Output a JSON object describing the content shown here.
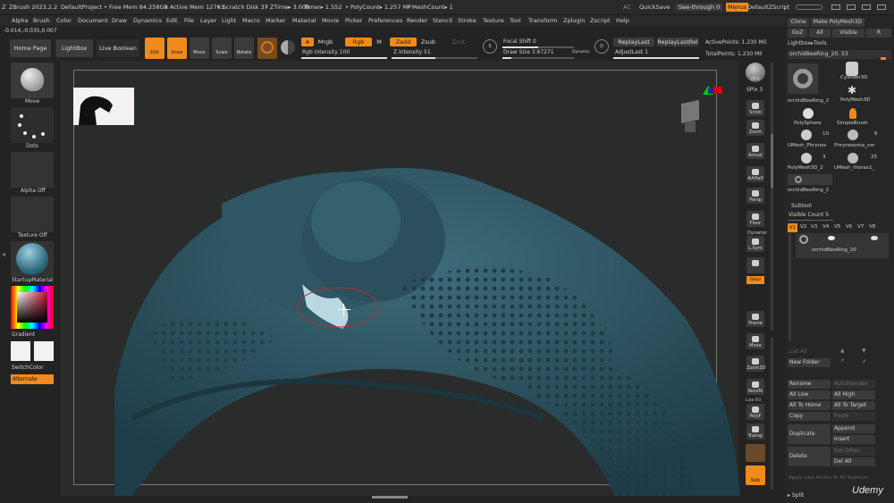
{
  "titlebar": {
    "app": "ZBrush 2023.2.2",
    "project": "DefaultProject",
    "freemem": "• Free Mem 84.258GB",
    "activemem": "• Active Mem 12763",
    "scratch": "• Scratch Disk 37",
    "ztime": "• ZTime▸ 3.008",
    "timer": "Timer▸ 1.552",
    "polycount": "• PolyCount▸ 1.257 MP",
    "meshcount": "• MeshCount▸ 1",
    "ac": "AC",
    "quicksave": "QuickSave",
    "seethrough": "See-through",
    "seethrough_val": "0",
    "menus": "Menus",
    "script": "DefaultZScript"
  },
  "menu": [
    "Alpha",
    "Brush",
    "Color",
    "Document",
    "Draw",
    "Dynamics",
    "Edit",
    "File",
    "Layer",
    "Light",
    "Macro",
    "Marker",
    "Material",
    "Movie",
    "Picker",
    "Preferences",
    "Render",
    "Stencil",
    "Stroke",
    "Texture",
    "Tool",
    "Transform",
    "Zplugin",
    "Zscript",
    "Help"
  ],
  "coords": "-0.014,-0.035,0.007",
  "toolbar": {
    "home": "Home Page",
    "lightbox": "LightBox",
    "liveboolean": "Live Boolean",
    "edit": "Edit",
    "draw": "Draw",
    "move": "Move",
    "scale": "Scale",
    "rotate": "Rotate",
    "a": "A",
    "mrgb": "Mrgb",
    "rgb": "Rgb",
    "m": "M",
    "zadd": "Zadd",
    "zsub": "Zsub",
    "zcut": "Zcut",
    "rgb_intensity": "Rgb Intensity 100",
    "z_intensity": "Z Intensity 51",
    "s": "S",
    "d": "D",
    "focal": "Focal Shift 0",
    "drawsize": "Draw Size 3.67271",
    "dynamic": "Dynamic",
    "replaylast": "ReplayLast",
    "replaylastrel": "ReplayLastRel",
    "adjustlast": "AdjustLast 1",
    "activepoints": "ActivePoints: 1.230 Mil",
    "totalpoints": "TotalPoints: 1.230 Mil",
    "rgb_intensity_value": 100,
    "z_intensity_value": 51
  },
  "leftshelf": {
    "move": "Move",
    "dots": "Dots",
    "alpha": "Alpha Off",
    "texture": "Texture Off",
    "material": "StartupMaterial",
    "gradient": "Gradient",
    "switchcolor": "SwitchColor",
    "alternate": "Alternate"
  },
  "rightshelf": {
    "bpr": "BPR",
    "spix": "SPix 3",
    "scroll": "Scroll",
    "zoom": "Zoom",
    "actual": "Actual",
    "aahalf": "AAHalf",
    "persp": "Persp",
    "floor": "Floor",
    "dynamic": "Dynamic",
    "lsym": "L.Sym",
    "xyz": "Gxyz",
    "frame": "Frame",
    "move": "Move",
    "zoom3d": "Zoom3D",
    "rotate": "RotaTe",
    "linefill": "Line Fill",
    "polyf": "PolyF",
    "transp": "Transp",
    "solo": "Solo"
  },
  "tool": {
    "clone": "Clone",
    "make": "Make PolyMesh3D",
    "goz": "GoZ",
    "all": "All",
    "visible": "Visible",
    "r": "R",
    "lightbox_tools": "Lightbox▸Tools",
    "current": "orchidBeeRing_20.",
    "current_num": "53",
    "thumbs": [
      {
        "label": "orchidBeeRing_2"
      },
      {
        "label": "Cylinder3D"
      },
      {
        "label": "PolyMesh3D"
      },
      {
        "label": "PolySphere"
      },
      {
        "label": "SimpleBrush"
      },
      {
        "label": "UMesh_Phrynos"
      },
      {
        "label": "Phrynosoma_cor"
      },
      {
        "label": "PolyMesh3D_2"
      },
      {
        "label": "UMesh_thorax1_"
      },
      {
        "label": "orchidBeeRing_2"
      }
    ],
    "num10": "10",
    "num6": "6",
    "num3": "3",
    "num25": "25"
  },
  "subtool": {
    "header": "Subtool",
    "visible_count": "Visible Count 5",
    "tabs": [
      "V1",
      "V2",
      "V3",
      "V4",
      "V5",
      "V6",
      "V7",
      "V8"
    ],
    "item": "orchidBeeRing_20",
    "listall": "List All",
    "newfolder": "New Folder",
    "rename": "Rename",
    "autoreorder": "AutoReorder",
    "alllow": "All Low",
    "allhigh": "All High",
    "alltohome": "All To Home",
    "alltotarget": "All To Target",
    "copy": "Copy",
    "paste": "Paste",
    "duplicate": "Duplicate",
    "append": "Append",
    "insert": "Insert",
    "delete": "Delete",
    "delother": "Del Other",
    "delall": "Del All",
    "applylast": "Apply Last Action To All Subtools",
    "split": "▸ Split"
  },
  "watermark": "Udemy",
  "colors": {
    "accent": "#f08a1c",
    "mesh": "#2f5563",
    "bg": "#232323"
  }
}
